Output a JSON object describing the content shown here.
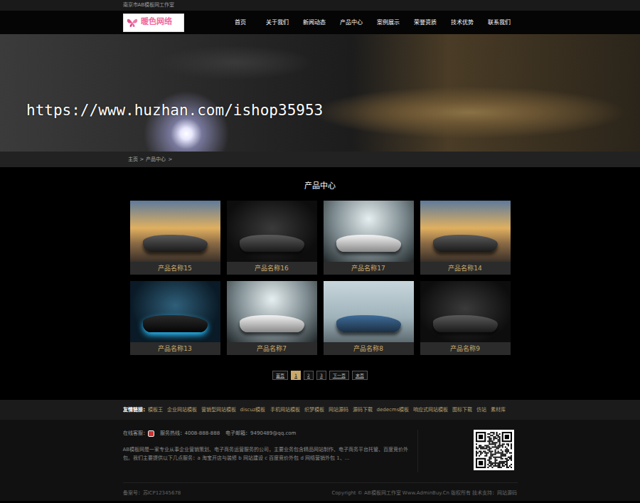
{
  "topbar": {
    "text": "南京市AB模板网工作室"
  },
  "logo": {
    "text": "暖色网络"
  },
  "nav": [
    {
      "label": "首页"
    },
    {
      "label": "关于我们"
    },
    {
      "label": "新闻动态"
    },
    {
      "label": "产品中心"
    },
    {
      "label": "案例展示"
    },
    {
      "label": "荣誉资质"
    },
    {
      "label": "技术优势"
    },
    {
      "label": "联系我们"
    }
  ],
  "banner": {
    "watermark": "https://www.huzhan.com/ishop35953"
  },
  "breadcrumb": {
    "items": [
      "主页",
      "产品中心"
    ],
    "separator": ">"
  },
  "section_title": "产品中心",
  "products": [
    {
      "name": "产品名称15"
    },
    {
      "name": "产品名称16"
    },
    {
      "name": "产品名称17"
    },
    {
      "name": "产品名称14"
    },
    {
      "name": "产品名称13"
    },
    {
      "name": "产品名称7"
    },
    {
      "name": "产品名称8"
    },
    {
      "name": "产品名称9"
    }
  ],
  "pagination": [
    {
      "label": "首页",
      "selected": false
    },
    {
      "label": "1",
      "selected": true
    },
    {
      "label": "2",
      "selected": false
    },
    {
      "label": "3",
      "selected": false
    },
    {
      "label": "下一页",
      "selected": false
    },
    {
      "label": "末页",
      "selected": false
    }
  ],
  "friend_links": {
    "label": "友情链接：",
    "links": [
      "模板王",
      "企业网站模板",
      "营销型网站模板",
      "discuz模板",
      "手机网站模板",
      "织梦模板",
      "网站源码",
      "源码下载",
      "dedecms模板",
      "响应式网站模板",
      "图标下载",
      "仿站",
      "素材库"
    ]
  },
  "footer": {
    "online_label": "在线客服：",
    "hotline": "服务热线：4008-888-888",
    "email": "电子邮箱：9490489@qq.com",
    "about": "AB模板网是一家专业从事企业营销策划、电子商务运营服务的公司，主要业务包含精品网站制作、电子商务平台托管、百度竞价外包。我们主要提供以下几点服务：a 淘宝开店与装修 b 网站建设 c 百度竞价外包 d 网络营销外包 1、...",
    "icp": "备案号：苏ICP12345678",
    "copyright": "Copyright © AB模板网工作室 Www.AdminBuy.Cn 版权所有 技术支持：网站源码"
  }
}
